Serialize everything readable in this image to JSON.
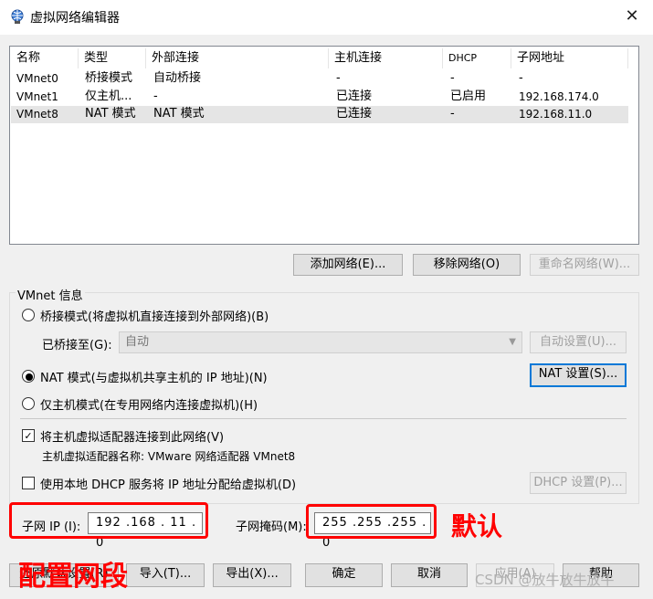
{
  "window": {
    "title": "虚拟网络编辑器",
    "close_icon": "close-icon"
  },
  "table": {
    "headers": [
      "名称",
      "类型",
      "外部连接",
      "主机连接",
      "DHCP",
      "子网地址"
    ],
    "rows": [
      [
        "VMnet0",
        "桥接模式",
        "自动桥接",
        "-",
        "-",
        "-"
      ],
      [
        "VMnet1",
        "仅主机...",
        "-",
        "已连接",
        "已启用",
        "192.168.174.0"
      ],
      [
        "VMnet8",
        "NAT 模式",
        "NAT 模式",
        "已连接",
        "-",
        "192.168.11.0"
      ]
    ],
    "selected_row": 2
  },
  "list_buttons": {
    "add": "添加网络(E)...",
    "remove": "移除网络(O)",
    "rename": "重命名网络(W)..."
  },
  "vmnet_info": {
    "label": "VMnet 信息",
    "bridge_radio": "桥接模式(将虚拟机直接连接到外部网络)(B)",
    "bridged_to_label": "已桥接至(G):",
    "bridged_to_value": "自动",
    "auto_settings": "自动设置(U)...",
    "nat_radio": "NAT 模式(与虚拟机共享主机的 IP 地址)(N)",
    "nat_settings": "NAT 设置(S)...",
    "hostonly_radio": "仅主机模式(在专用网络内连接虚拟机)(H)",
    "connect_adapter_check": "将主机虚拟适配器连接到此网络(V)",
    "adapter_name": "主机虚拟适配器名称: VMware 网络适配器 VMnet8",
    "dhcp_check": "使用本地 DHCP 服务将 IP 地址分配给虚拟机(D)",
    "dhcp_settings": "DHCP 设置(P)...",
    "subnet_ip_label": "子网 IP (I):",
    "subnet_ip_value": "192 .168 . 11 .  0",
    "subnet_mask_label": "子网掩码(M):",
    "subnet_mask_value": "255 .255 .255 .  0"
  },
  "bottom_buttons": {
    "restore": "还原默认设置(R)",
    "import": "导入(T)...",
    "export": "导出(X)...",
    "ok": "确定",
    "cancel": "取消",
    "apply": "应用(A)",
    "help": "帮助"
  },
  "annotations": {
    "default": "默认",
    "config": "配置网段",
    "color": "#ff0000"
  },
  "watermark": "CSDN @放牛放牛放牛"
}
